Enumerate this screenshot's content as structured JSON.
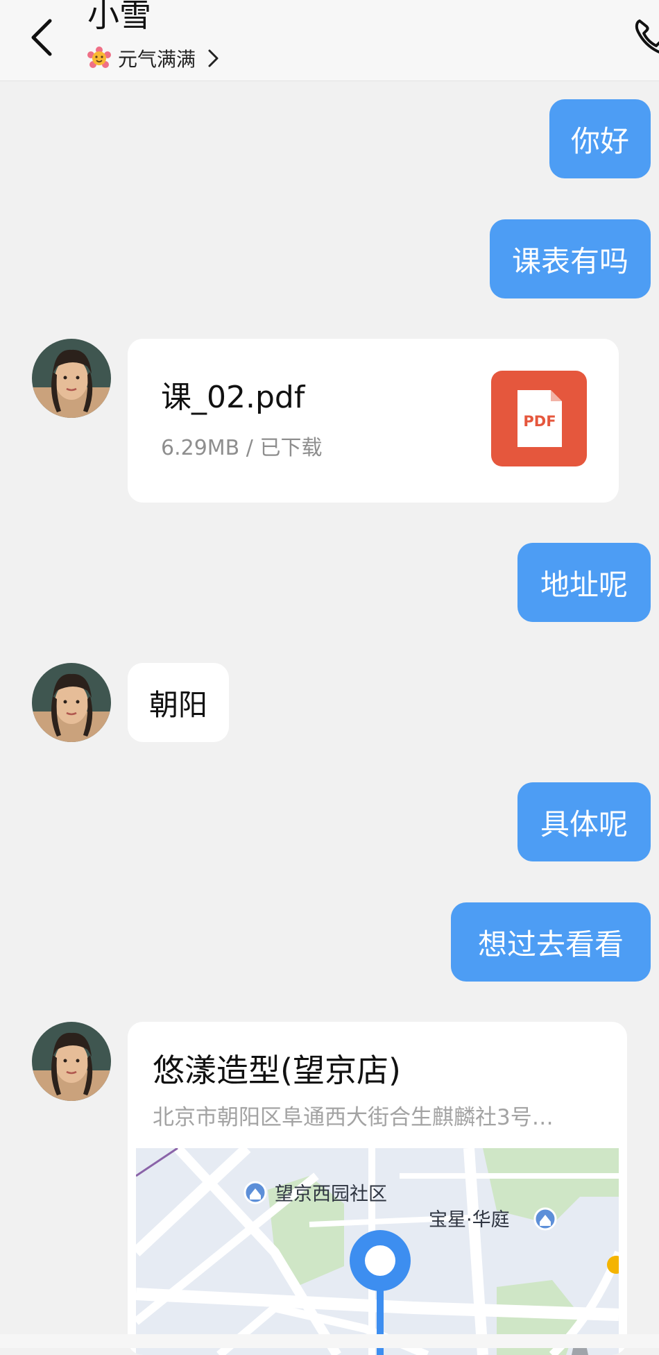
{
  "header": {
    "title": "小雪",
    "status": "元气满满"
  },
  "messages": {
    "m1": "你好",
    "m2": "课表有吗",
    "file": {
      "name": "课_02.pdf",
      "meta": "6.29MB / 已下载",
      "icon_label": "PDF"
    },
    "m3": "地址呢",
    "m4": "朝阳",
    "m5": "具体呢",
    "m6": "想过去看看",
    "location": {
      "name": "悠漾造型(望京店)",
      "address": "北京市朝阳区阜通西大街合生麒麟社3号…",
      "map_labels": {
        "poi1": "望京西园社区",
        "poi2": "宝星·华庭"
      }
    }
  },
  "colors": {
    "outgoing_bubble": "#4d9df4",
    "pdf_icon": "#e5573d",
    "map_pin": "#3d8ef0"
  },
  "icons": [
    "back-icon",
    "mood-emoji-icon",
    "chevron-right-icon",
    "phone-icon",
    "pdf-file-icon",
    "map-pin-icon"
  ]
}
